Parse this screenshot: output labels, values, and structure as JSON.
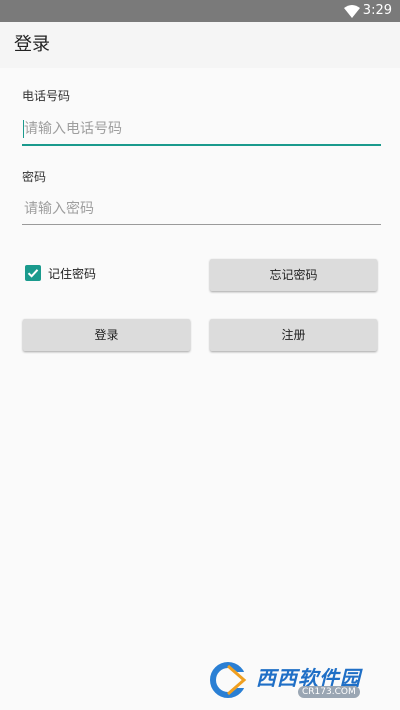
{
  "status_bar": {
    "time": "3:29",
    "icons": [
      "wifi-icon"
    ]
  },
  "app_bar": {
    "title": "登录"
  },
  "form": {
    "phone_label": "电话号码",
    "phone_placeholder": "请输入电话号码",
    "password_label": "密码",
    "password_placeholder": "请输入密码",
    "remember_label": "记住密码",
    "remember_checked": true,
    "forgot_button": "忘记密码",
    "login_button": "登录",
    "register_button": "注册"
  },
  "watermark": {
    "name": "西西软件园",
    "url": "CR173.COM"
  },
  "colors": {
    "accent": "#1a9a8d",
    "status_bar": "#7a7a7a",
    "button": "#dcdcdc",
    "background": "#fafafa"
  }
}
